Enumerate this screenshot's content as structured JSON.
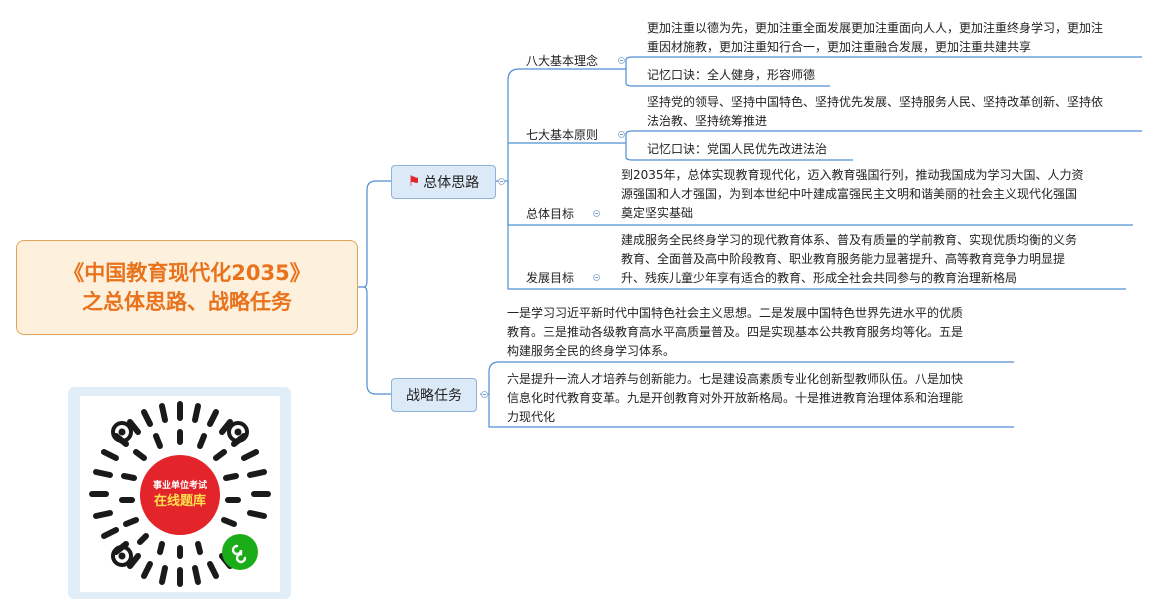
{
  "root": {
    "line1": "《中国教育现代化2035》",
    "line2": "之总体思路、战略任务",
    "color": "#e8731c"
  },
  "overall": {
    "label": "总体思路",
    "icon": "flag-icon",
    "concepts": {
      "label": "八大基本理念",
      "content_line1": "更加注重以德为先，更加注重全面发展更加注重面向人人，更加注重终身学习，更加注",
      "content_line2": "重因材施教，更加注重知行合一，更加注重融合发展，更加注重共建共享",
      "memo": "记忆口诀：全人健身，形容师德"
    },
    "principles": {
      "label": "七大基本原则",
      "content_line1": "坚持党的领导、坚持中国特色、坚持优先发展、坚持服务人民、坚持改革创新、坚持依",
      "content_line2": "法治教、坚持统筹推进",
      "memo": "记忆口诀：党国人民优先改进法治"
    },
    "goal": {
      "label": "总体目标",
      "line1": "到2035年，总体实现教育现代化，迈入教育强国行列，推动我国成为学习大国、人力资",
      "line2": "源强国和人才强国，为到本世纪中叶建成富强民主文明和谐美丽的社会主义现代化强国",
      "line3": "奠定坚实基础"
    },
    "dev": {
      "label": "发展目标",
      "line1": "建成服务全民终身学习的现代教育体系、普及有质量的学前教育、实现优质均衡的义务",
      "line2": "教育、全面普及高中阶段教育、职业教育服务能力显著提升、高等教育竞争力明显提",
      "line3": "升、残疾儿童少年享有适合的教育、形成全社会共同参与的教育治理新格局"
    }
  },
  "strategy": {
    "label": "战略任务",
    "block1": {
      "line1": "一是学习习近平新时代中国特色社会主义思想。二是发展中国特色世界先进水平的优质",
      "line2": "教育。三是推动各级教育高水平高质量普及。四是实现基本公共教育服务均等化。五是",
      "line3": "构建服务全民的终身学习体系。"
    },
    "block2": {
      "line1": "六是提升一流人才培养与创新能力。七是建设高素质专业化创新型教师队伍。八是加快",
      "line2": "信息化时代教育变革。九是开创教育对外开放新格局。十是推进教育治理体系和治理能",
      "line3": "力现代化"
    }
  },
  "qr": {
    "center_line1": "事业单位考试",
    "center_line2": "在线题库",
    "badge_icon": "mini-program-icon"
  },
  "colors": {
    "line": "#4f8fd1",
    "node_bg": "#dce9f7",
    "root_bg": "#fdf0dc",
    "flag": "#e3242b"
  }
}
